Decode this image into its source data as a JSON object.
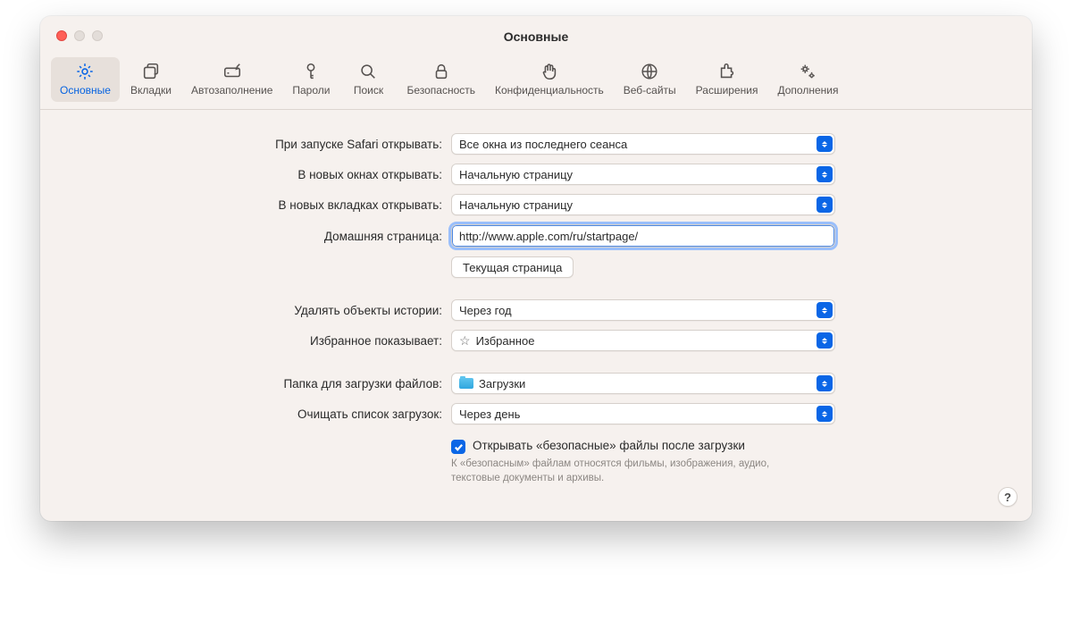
{
  "window": {
    "title": "Основные"
  },
  "toolbar": [
    {
      "id": "general",
      "label": "Основные",
      "selected": true
    },
    {
      "id": "tabs",
      "label": "Вкладки",
      "selected": false
    },
    {
      "id": "autofill",
      "label": "Автозаполнение",
      "selected": false
    },
    {
      "id": "passwords",
      "label": "Пароли",
      "selected": false
    },
    {
      "id": "search",
      "label": "Поиск",
      "selected": false
    },
    {
      "id": "security",
      "label": "Безопасность",
      "selected": false
    },
    {
      "id": "privacy",
      "label": "Конфиденциальность",
      "selected": false
    },
    {
      "id": "websites",
      "label": "Веб-сайты",
      "selected": false
    },
    {
      "id": "extensions",
      "label": "Расширения",
      "selected": false
    },
    {
      "id": "advanced",
      "label": "Дополнения",
      "selected": false
    }
  ],
  "labels": {
    "on_launch": "При запуске Safari открывать:",
    "new_windows": "В новых окнах открывать:",
    "new_tabs": "В новых вкладках открывать:",
    "homepage": "Домашняя страница:",
    "current_page_btn": "Текущая страница",
    "history_remove": "Удалять объекты истории:",
    "favorites_shows": "Избранное показывает:",
    "download_folder": "Папка для загрузки файлов:",
    "clear_downloads": "Очищать список загрузок:"
  },
  "values": {
    "on_launch": "Все окна из последнего сеанса",
    "new_windows": "Начальную страницу",
    "new_tabs": "Начальную страницу",
    "homepage": "http://www.apple.com/ru/startpage/",
    "history_remove": "Через год",
    "favorites_shows": "Избранное",
    "download_folder": "Загрузки",
    "clear_downloads": "Через день"
  },
  "safe_files": {
    "checked": true,
    "label": "Открывать «безопасные» файлы после загрузки",
    "note": "К «безопасным» файлам относятся фильмы, изображения, аудио, текстовые документы и архивы."
  },
  "help": "?"
}
